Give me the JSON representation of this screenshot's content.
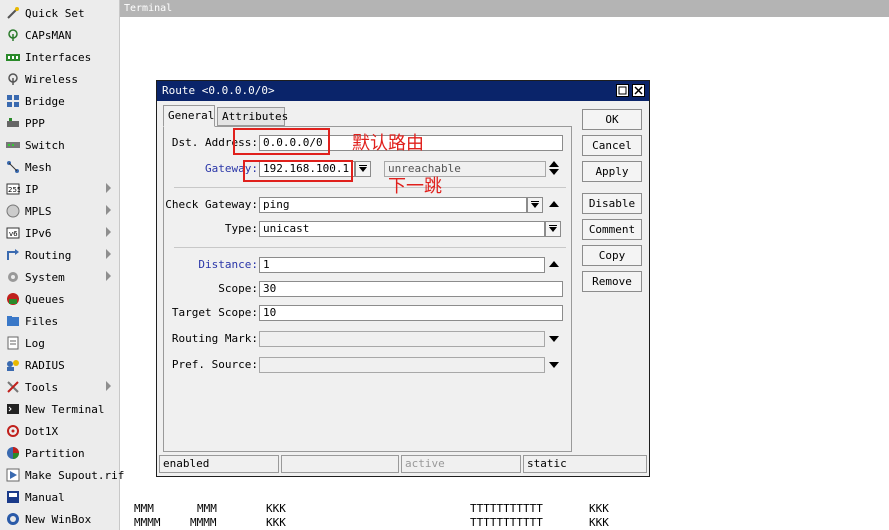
{
  "sidebar": {
    "items": [
      {
        "label": "Quick Set",
        "icon": "wand-icon",
        "submenu": false
      },
      {
        "label": "CAPsMAN",
        "icon": "antenna-icon",
        "submenu": false
      },
      {
        "label": "Interfaces",
        "icon": "interfaces-icon",
        "submenu": false
      },
      {
        "label": "Wireless",
        "icon": "wireless-icon",
        "submenu": false
      },
      {
        "label": "Bridge",
        "icon": "bridge-icon",
        "submenu": false
      },
      {
        "label": "PPP",
        "icon": "ppp-icon",
        "submenu": false
      },
      {
        "label": "Switch",
        "icon": "switch-icon",
        "submenu": false
      },
      {
        "label": "Mesh",
        "icon": "mesh-icon",
        "submenu": false
      },
      {
        "label": "IP",
        "icon": "ip-icon",
        "submenu": true
      },
      {
        "label": "MPLS",
        "icon": "mpls-icon",
        "submenu": true
      },
      {
        "label": "IPv6",
        "icon": "ipv6-icon",
        "submenu": true
      },
      {
        "label": "Routing",
        "icon": "routing-icon",
        "submenu": true
      },
      {
        "label": "System",
        "icon": "gear-icon",
        "submenu": true
      },
      {
        "label": "Queues",
        "icon": "queues-icon",
        "submenu": false
      },
      {
        "label": "Files",
        "icon": "folder-icon",
        "submenu": false
      },
      {
        "label": "Log",
        "icon": "log-icon",
        "submenu": false
      },
      {
        "label": "RADIUS",
        "icon": "radius-icon",
        "submenu": false
      },
      {
        "label": "Tools",
        "icon": "tools-icon",
        "submenu": true
      },
      {
        "label": "New Terminal",
        "icon": "terminal-icon",
        "submenu": false
      },
      {
        "label": "Dot1X",
        "icon": "dot1x-icon",
        "submenu": false
      },
      {
        "label": "Partition",
        "icon": "partition-icon",
        "submenu": false
      },
      {
        "label": "Make Supout.rif",
        "icon": "supout-icon",
        "submenu": false
      },
      {
        "label": "Manual",
        "icon": "manual-icon",
        "submenu": false
      },
      {
        "label": "New WinBox",
        "icon": "winbox-icon",
        "submenu": false
      }
    ]
  },
  "terminal": {
    "title": "Terminal",
    "lines": [
      [
        "MMM",
        "MMM",
        "KKK",
        "TTTTTTTTTTT",
        "KKK"
      ],
      [
        "MMMM",
        "MMMM",
        "KKK",
        "TTTTTTTTTTT",
        "KKK"
      ]
    ]
  },
  "route_window": {
    "title": "Route <0.0.0.0/0>",
    "tabs": [
      "General",
      "Attributes"
    ],
    "fields": {
      "dst_address": {
        "label": "Dst. Address:",
        "value": "0.0.0.0/0"
      },
      "gateway": {
        "label": "Gateway:",
        "value": "192.168.100.1",
        "status": "unreachable"
      },
      "check_gateway": {
        "label": "Check Gateway:",
        "value": "ping"
      },
      "type": {
        "label": "Type:",
        "value": "unicast"
      },
      "distance": {
        "label": "Distance:",
        "value": "1"
      },
      "scope": {
        "label": "Scope:",
        "value": "30"
      },
      "target_scope": {
        "label": "Target Scope:",
        "value": "10"
      },
      "routing_mark": {
        "label": "Routing Mark:",
        "value": ""
      },
      "pref_source": {
        "label": "Pref. Source:",
        "value": ""
      }
    },
    "buttons": [
      "OK",
      "Cancel",
      "Apply",
      "Disable",
      "Comment",
      "Copy",
      "Remove"
    ],
    "status": [
      "enabled",
      "",
      "active",
      "static"
    ]
  },
  "annotations": {
    "default_route": "默认路由",
    "next_hop": "下一跳"
  },
  "colors": {
    "title_bar": "#0a246a",
    "annotation": "#e0201c",
    "label_blue": "#2a36a8"
  }
}
